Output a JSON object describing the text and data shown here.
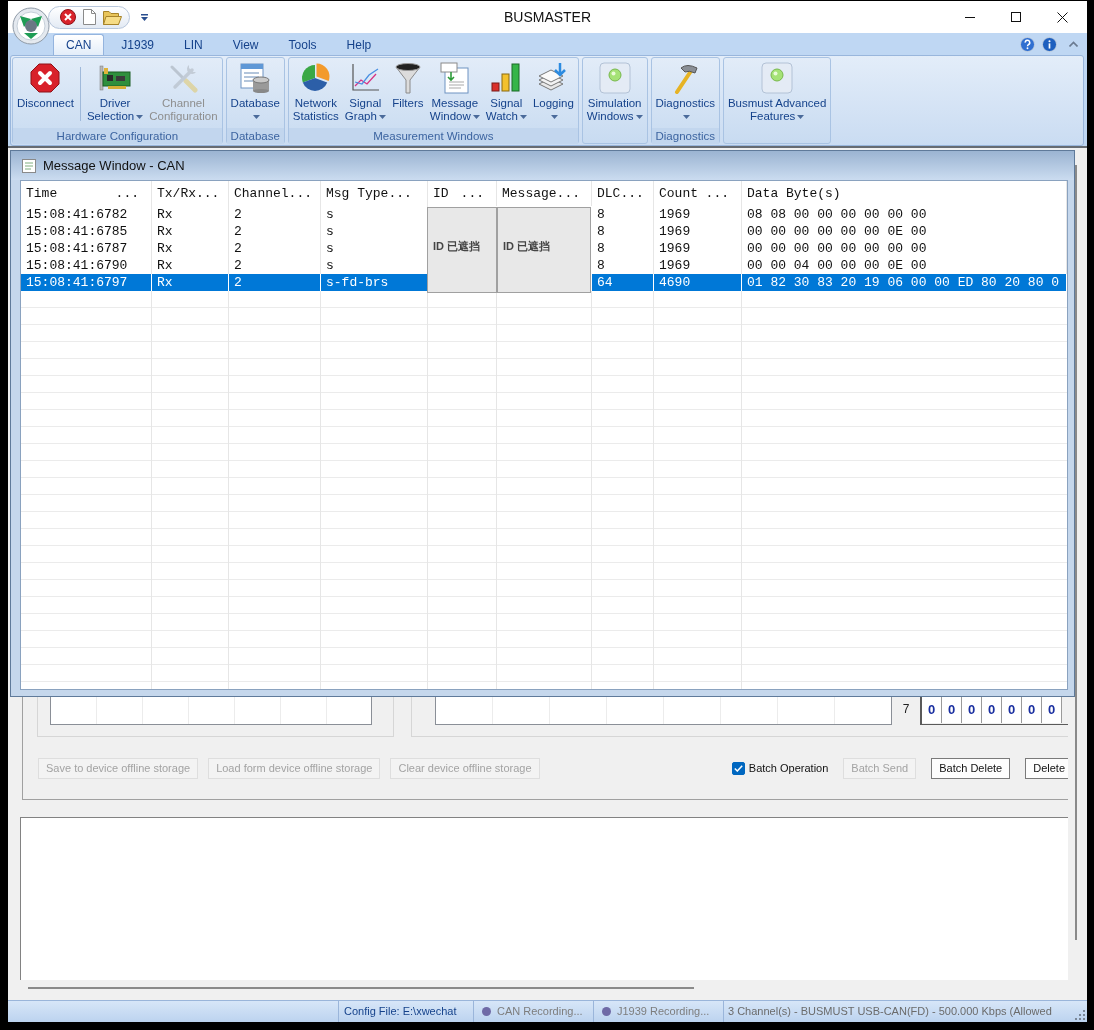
{
  "window": {
    "title": "BUSMASTER"
  },
  "ribbon_tabs": [
    {
      "label": "CAN",
      "selected": true
    },
    {
      "label": "J1939",
      "selected": false
    },
    {
      "label": "LIN",
      "selected": false
    },
    {
      "label": "View",
      "selected": false
    },
    {
      "label": "Tools",
      "selected": false
    },
    {
      "label": "Help",
      "selected": false
    }
  ],
  "ribbon_groups": [
    {
      "label": "Hardware Configuration",
      "buttons": [
        {
          "lines": [
            "Disconnect"
          ],
          "dropdown": false,
          "disabled": false,
          "separator_after": true
        },
        {
          "lines": [
            "Driver",
            "Selection"
          ],
          "dropdown": true,
          "disabled": false
        },
        {
          "lines": [
            "Channel",
            "Configuration"
          ],
          "dropdown": false,
          "disabled": true
        }
      ]
    },
    {
      "label": "Database",
      "buttons": [
        {
          "lines": [
            "Database"
          ],
          "dropdown": true,
          "disabled": false
        }
      ]
    },
    {
      "label": "Measurement Windows",
      "buttons": [
        {
          "lines": [
            "Network",
            "Statistics"
          ],
          "dropdown": false,
          "disabled": false
        },
        {
          "lines": [
            "Signal",
            "Graph"
          ],
          "dropdown": true,
          "disabled": false
        },
        {
          "lines": [
            "Filters"
          ],
          "dropdown": false,
          "disabled": false
        },
        {
          "lines": [
            "Message",
            "Window"
          ],
          "dropdown": true,
          "disabled": false
        },
        {
          "lines": [
            "Signal",
            "Watch"
          ],
          "dropdown": true,
          "disabled": false
        },
        {
          "lines": [
            "Logging"
          ],
          "dropdown": true,
          "disabled": false
        }
      ]
    },
    {
      "buttons": [
        {
          "lines": [
            "Simulation",
            "Windows"
          ],
          "dropdown": true,
          "disabled": false
        }
      ]
    },
    {
      "label": "Diagnostics",
      "buttons": [
        {
          "lines": [
            "Diagnostics"
          ],
          "dropdown": true,
          "disabled": false
        }
      ]
    },
    {
      "buttons": [
        {
          "lines": [
            "Busmust Advanced",
            "Features"
          ],
          "dropdown": true,
          "disabled": false
        }
      ]
    }
  ],
  "message_window": {
    "title": "Message Window - CAN",
    "columns": [
      {
        "label": "Time",
        "ellipsis": "..."
      },
      {
        "label": "Tx/Rx..."
      },
      {
        "label": "Channel..."
      },
      {
        "label": "Msg Type..."
      },
      {
        "label": "ID",
        "ellipsis": "..."
      },
      {
        "label": "Message..."
      },
      {
        "label": "DLC..."
      },
      {
        "label": "Count",
        "ellipsis": "..."
      },
      {
        "label": "Data Byte(s)"
      }
    ],
    "rows": [
      {
        "time": "15:08:41:6782",
        "tx_rx": "Rx",
        "channel": "2",
        "msg_type": "s",
        "dlc": "8",
        "count": "1969",
        "data_bytes": "08 08 00 00 00 00 00 00",
        "selected": false
      },
      {
        "time": "15:08:41:6785",
        "tx_rx": "Rx",
        "channel": "2",
        "msg_type": "s",
        "dlc": "8",
        "count": "1969",
        "data_bytes": "00 00 00 00 00 00 0E 00",
        "selected": false
      },
      {
        "time": "15:08:41:6787",
        "tx_rx": "Rx",
        "channel": "2",
        "msg_type": "s",
        "dlc": "8",
        "count": "1969",
        "data_bytes": "00 00 00 00 00 00 00 00",
        "selected": false
      },
      {
        "time": "15:08:41:6790",
        "tx_rx": "Rx",
        "channel": "2",
        "msg_type": "s",
        "dlc": "8",
        "count": "1969",
        "data_bytes": "00 00 04 00 00 00 0E 00",
        "selected": false
      },
      {
        "time": "15:08:41:6797",
        "tx_rx": "Rx",
        "channel": "2",
        "msg_type": "s-fd-brs",
        "dlc": "64",
        "count": "4690",
        "data_bytes": "01 82 30 83 20 19 06 00 00 ED 80 20 80 0",
        "selected": true
      }
    ],
    "masks": [
      {
        "text": "ID 已遮挡"
      },
      {
        "text": "ID 已遮挡"
      }
    ]
  },
  "lower_panel": {
    "bit_label": "7",
    "bits": [
      "0",
      "0",
      "0",
      "0",
      "0",
      "0",
      "0"
    ],
    "storage_buttons": [
      {
        "label": "Save to device offline storage",
        "disabled": true
      },
      {
        "label": "Load form device offline storage",
        "disabled": true
      },
      {
        "label": "Clear device offline storage",
        "disabled": true
      }
    ],
    "batch_operation": {
      "label": "Batch Operation",
      "checked": true
    },
    "batch_buttons": [
      {
        "label": "Batch Send",
        "disabled": true
      },
      {
        "label": "Batch Delete",
        "disabled": false
      },
      {
        "label": "Delete",
        "disabled": false
      }
    ]
  },
  "status_bar": {
    "config_file": "Config File: E:\\xwechat",
    "recordings": [
      {
        "label": "CAN Recording..."
      },
      {
        "label": "J1939 Recording..."
      }
    ],
    "channels": "3 Channel(s) - BUSMUST USB-CAN(FD) - 500.000 Kbps (Allowed"
  }
}
